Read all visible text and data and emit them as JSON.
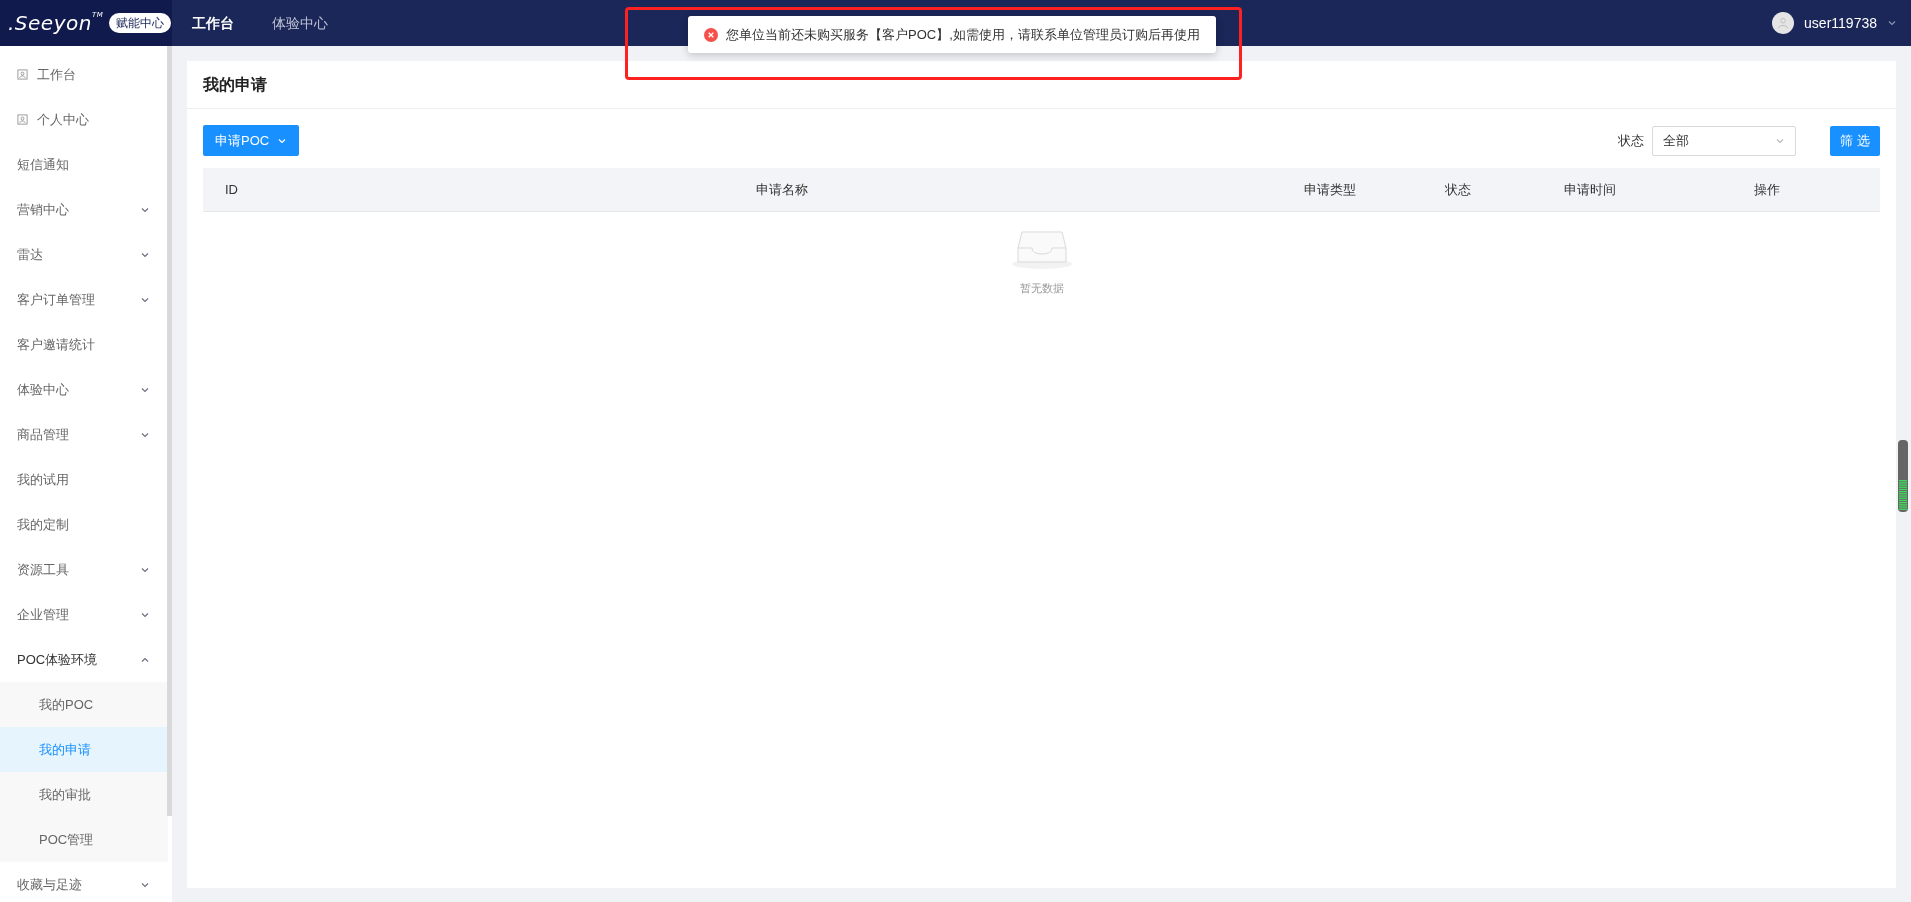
{
  "header": {
    "logo": {
      "text": ".Seeyon",
      "tm": "TM"
    },
    "badge": "赋能中心",
    "nav": [
      {
        "label": "工作台",
        "selected": true
      },
      {
        "label": "体验中心",
        "selected": false
      }
    ],
    "user": "user119738"
  },
  "toast": {
    "kind": "error",
    "message": "您单位当前还未购买服务【客户POC】,如需使用，请联系单位管理员订购后再使用",
    "highlighted": true
  },
  "sidebar": {
    "items": [
      {
        "label": "工作台",
        "kind": "icon"
      },
      {
        "label": "个人中心",
        "kind": "icon"
      },
      {
        "label": "短信通知",
        "kind": "plain"
      },
      {
        "label": "营销中心",
        "kind": "group",
        "expanded": false
      },
      {
        "label": "雷达",
        "kind": "group",
        "expanded": false
      },
      {
        "label": "客户订单管理",
        "kind": "group",
        "expanded": false
      },
      {
        "label": "客户邀请统计",
        "kind": "plain"
      },
      {
        "label": "体验中心",
        "kind": "group",
        "expanded": false
      },
      {
        "label": "商品管理",
        "kind": "group",
        "expanded": false
      },
      {
        "label": "我的试用",
        "kind": "plain"
      },
      {
        "label": "我的定制",
        "kind": "plain"
      },
      {
        "label": "资源工具",
        "kind": "group",
        "expanded": false
      },
      {
        "label": "企业管理",
        "kind": "group",
        "expanded": false
      },
      {
        "label": "POC体验环境",
        "kind": "group",
        "expanded": true,
        "children": [
          {
            "label": "我的POC",
            "selected": false
          },
          {
            "label": "我的申请",
            "selected": true
          },
          {
            "label": "我的审批",
            "selected": false
          },
          {
            "label": "POC管理",
            "selected": false
          }
        ]
      },
      {
        "label": "收藏与足迹",
        "kind": "group",
        "expanded": false
      }
    ]
  },
  "page": {
    "title": "我的申请",
    "apply_button": "申请POC",
    "status_filter": {
      "label": "状态",
      "value": "全部"
    },
    "filter_button": "筛 选",
    "table": {
      "columns": [
        "ID",
        "申请名称",
        "申请类型",
        "状态",
        "申请时间",
        "操作"
      ],
      "empty_text": "暂无数据"
    }
  }
}
